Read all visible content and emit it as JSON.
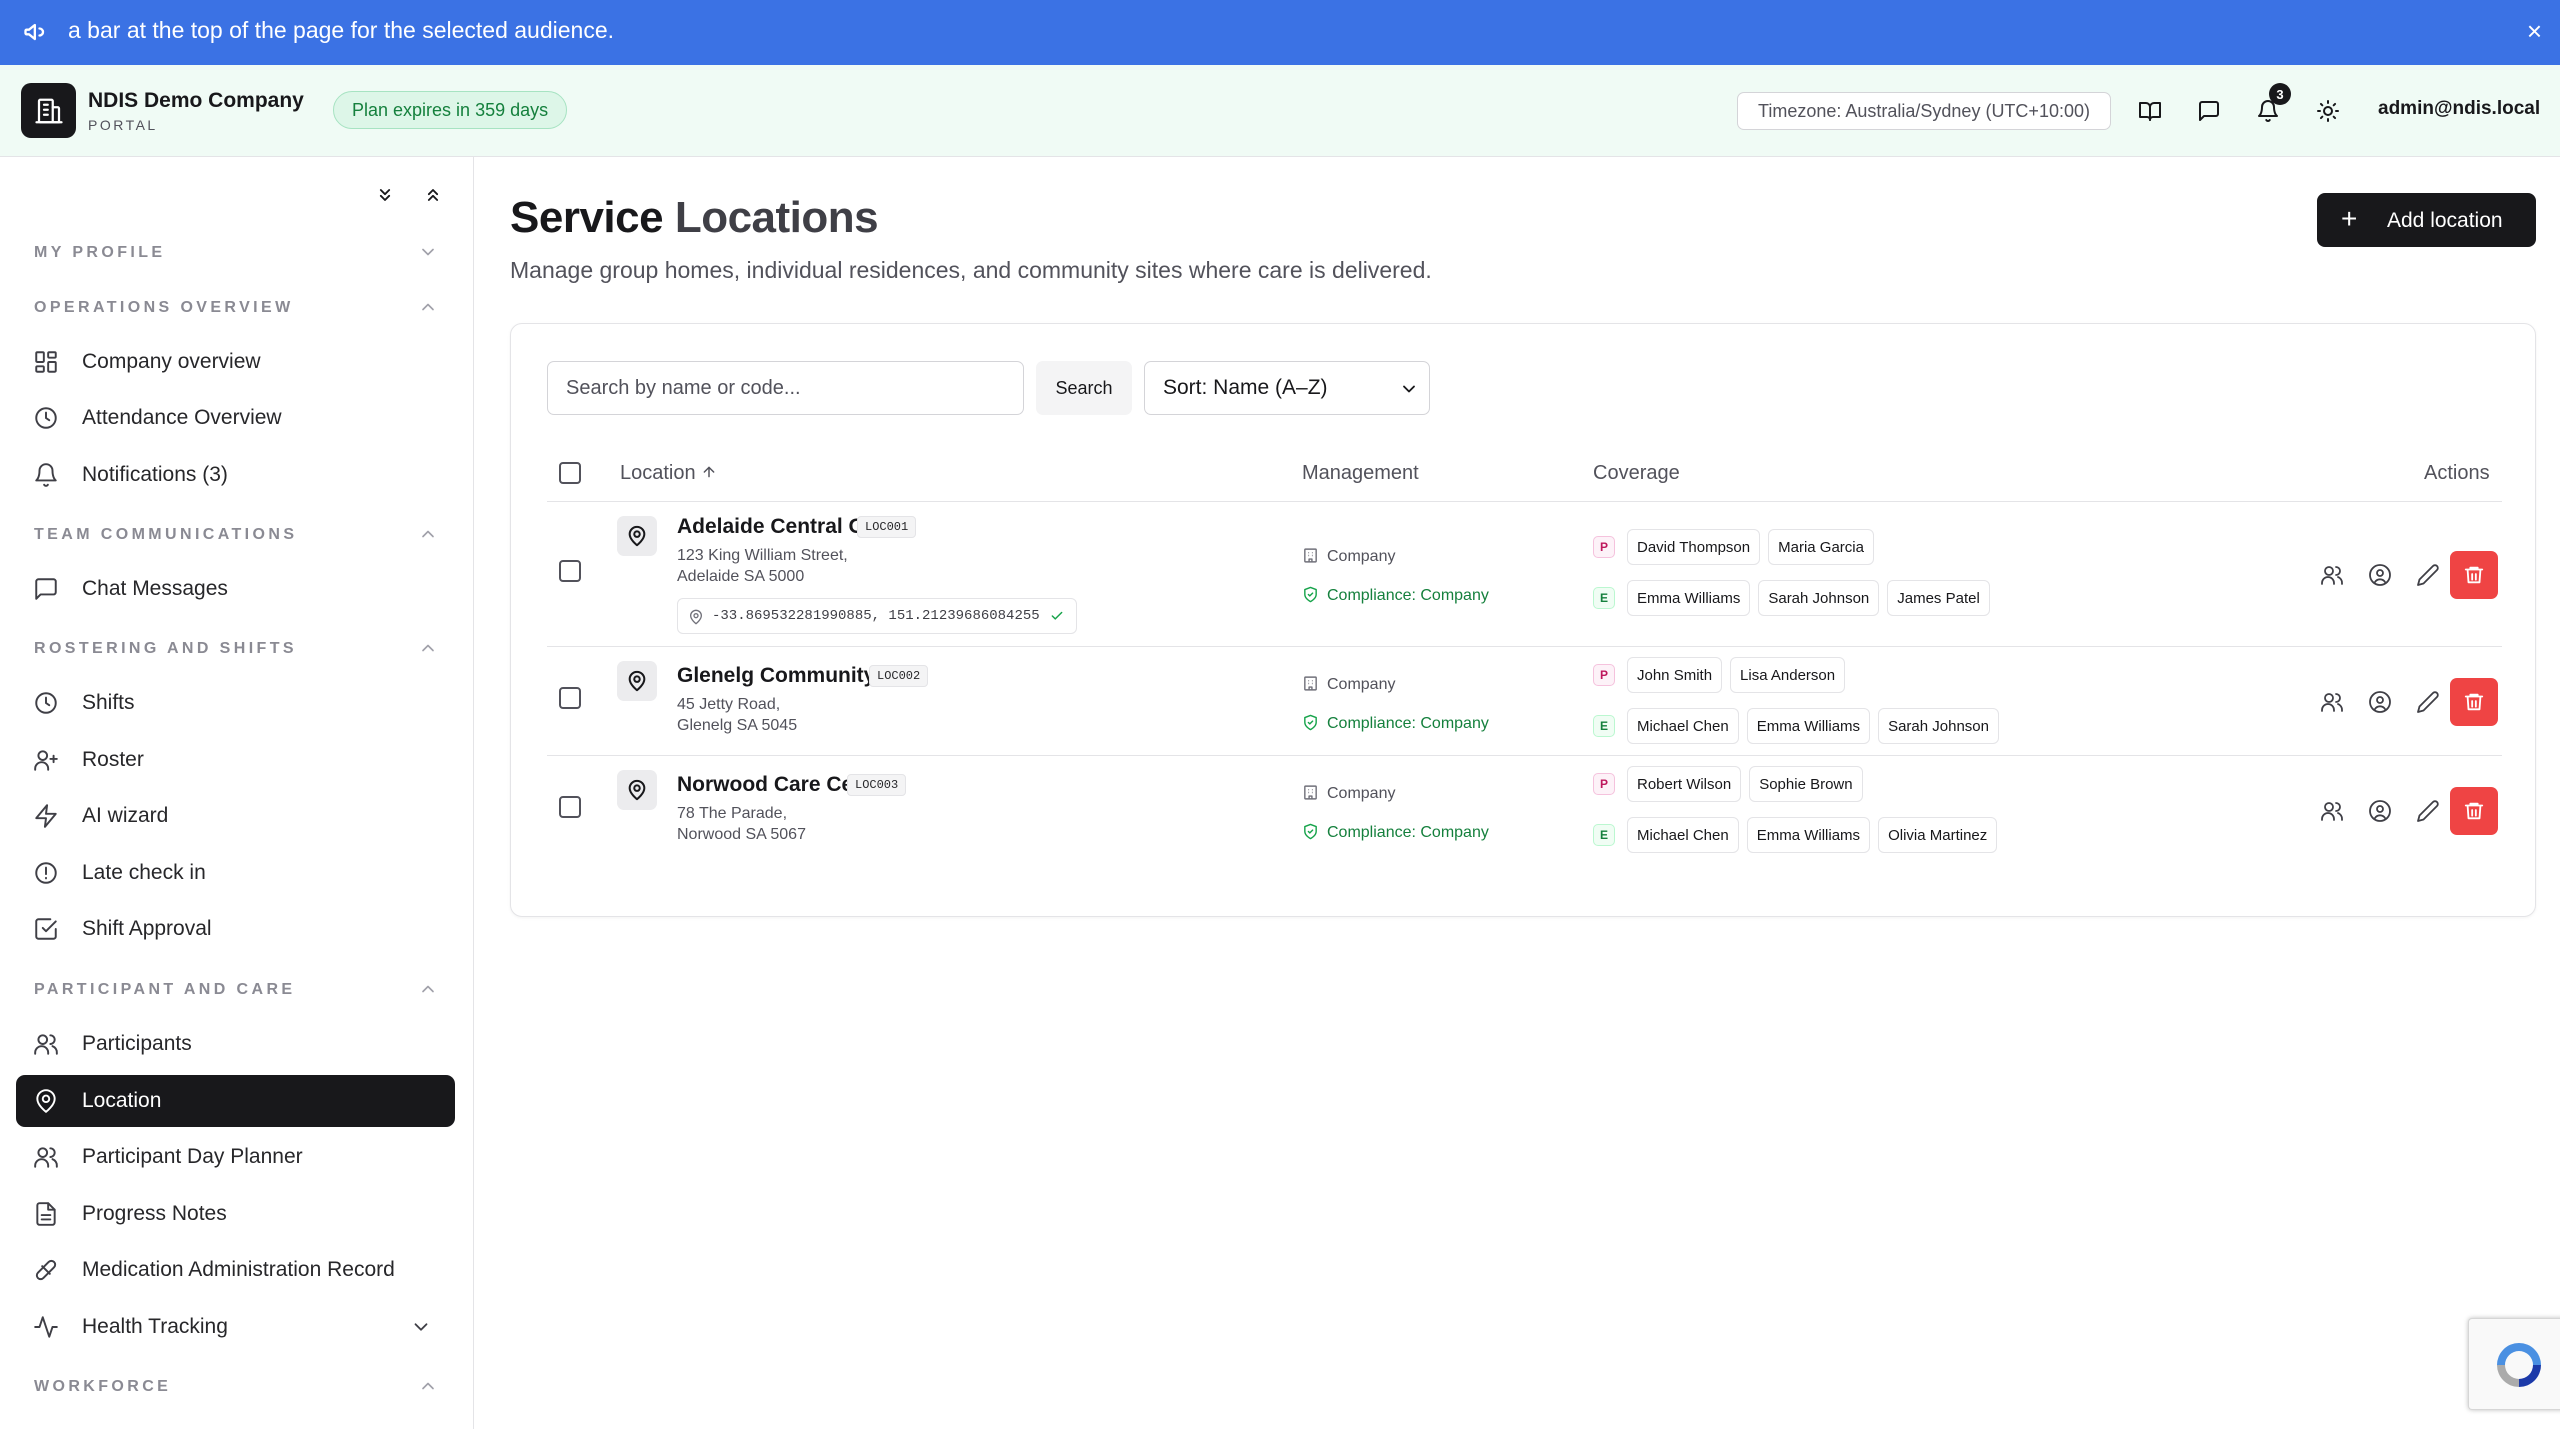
{
  "announcement": {
    "text": "a bar at the top of the page for the selected audience.",
    "close": "×"
  },
  "header": {
    "company": "NDIS Demo Company",
    "portal": "PORTAL",
    "plan_badge": "Plan expires in 359 days",
    "timezone": "Timezone: Australia/Sydney (UTC+10:00)",
    "notification_count": "3",
    "user_email": "admin@ndis.local"
  },
  "sidebar": {
    "sections": [
      {
        "title": "MY PROFILE",
        "expanded": false,
        "items": []
      },
      {
        "title": "OPERATIONS OVERVIEW",
        "expanded": true,
        "items": [
          {
            "label": "Company overview",
            "icon": "grid-icon"
          },
          {
            "label": "Attendance Overview",
            "icon": "clock-icon"
          },
          {
            "label": "Notifications (3)",
            "icon": "bell-icon"
          }
        ]
      },
      {
        "title": "TEAM COMMUNICATIONS",
        "expanded": true,
        "items": [
          {
            "label": "Chat Messages",
            "icon": "message-square-icon"
          }
        ]
      },
      {
        "title": "ROSTERING AND SHIFTS",
        "expanded": true,
        "items": [
          {
            "label": "Shifts",
            "icon": "clock-icon"
          },
          {
            "label": "Roster",
            "icon": "user-plus-icon"
          },
          {
            "label": "AI wizard",
            "icon": "zap-icon"
          },
          {
            "label": "Late check in",
            "icon": "alert-circle-icon"
          },
          {
            "label": "Shift Approval",
            "icon": "check-square-icon"
          }
        ]
      },
      {
        "title": "PARTICIPANT AND CARE",
        "expanded": true,
        "items": [
          {
            "label": "Participants",
            "icon": "users-icon"
          },
          {
            "label": "Location",
            "icon": "map-pin-icon",
            "active": true
          },
          {
            "label": "Participant Day Planner",
            "icon": "users-icon"
          },
          {
            "label": "Progress Notes",
            "icon": "file-text-icon"
          },
          {
            "label": "Medication Administration Record",
            "icon": "pill-icon"
          },
          {
            "label": "Health Tracking",
            "icon": "activity-icon"
          }
        ]
      },
      {
        "title": "WORKFORCE",
        "expanded": true,
        "items": []
      }
    ]
  },
  "page": {
    "title_a": "Service",
    "title_b": "Locations",
    "description": "Manage group homes, individual residences, and community sites where care is delivered.",
    "add_button": "Add location",
    "search_placeholder": "Search by name or code...",
    "search_button": "Search",
    "sort_value": "Sort: Name (A–Z)"
  },
  "table": {
    "columns": {
      "location": "Location",
      "management": "Management",
      "coverage": "Coverage",
      "actions": "Actions"
    },
    "rows": [
      {
        "name": "Adelaide Central Office",
        "code": "LOC001",
        "address_1": "123 King William Street,",
        "address_2": "Adelaide SA 5000",
        "coords": "-33.869532281990885, 151.21239686084255",
        "management": "Company",
        "compliance": "Compliance: Company",
        "participants_tag": "P",
        "participants": [
          "David Thompson",
          "Maria Garcia"
        ],
        "employees_tag": "E",
        "employees": [
          "Emma Williams",
          "Sarah Johnson",
          "James Patel"
        ]
      },
      {
        "name": "Glenelg Community Hub",
        "code": "LOC002",
        "address_1": "45 Jetty Road,",
        "address_2": "Glenelg SA 5045",
        "management": "Company",
        "compliance": "Compliance: Company",
        "participants_tag": "P",
        "participants": [
          "John Smith",
          "Lisa Anderson"
        ],
        "employees_tag": "E",
        "employees": [
          "Michael Chen",
          "Emma Williams",
          "Sarah Johnson"
        ]
      },
      {
        "name": "Norwood Care Center",
        "code": "LOC003",
        "address_1": "78 The Parade,",
        "address_2": "Norwood SA 5067",
        "management": "Company",
        "compliance": "Compliance: Company",
        "participants_tag": "P",
        "participants": [
          "Robert Wilson",
          "Sophie Brown"
        ],
        "employees_tag": "E",
        "employees": [
          "Michael Chen",
          "Emma Williams",
          "Olivia Martinez"
        ]
      }
    ]
  },
  "colors": {
    "announce": "#3b72e4",
    "accent_dark": "#18181b",
    "danger": "#ef4444",
    "success": "#15803d"
  }
}
